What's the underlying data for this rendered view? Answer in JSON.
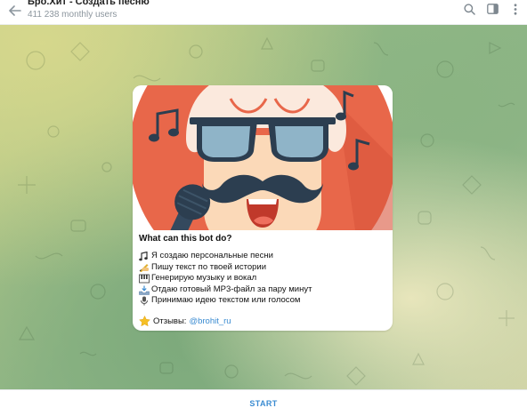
{
  "header": {
    "title": "Бро.Хит - Создать песню",
    "subtitle": "411 238 monthly users",
    "icons": [
      "back-arrow-icon",
      "search-icon",
      "sidebar-icon",
      "more-vertical-icon"
    ]
  },
  "card": {
    "title": "What can this bot do?",
    "features": [
      {
        "icon": "musical-notes-icon",
        "text": "Я создаю персональные песни"
      },
      {
        "icon": "writing-hand-icon",
        "text": "Пишу текст по твоей истории"
      },
      {
        "icon": "piano-icon",
        "text": "Генерирую музыку и вокал"
      },
      {
        "icon": "inbox-tray-icon",
        "text": "Отдаю готовый MP3-файл за пару минут"
      },
      {
        "icon": "microphone-icon",
        "text": "Принимаю идею текстом или голосом"
      }
    ],
    "review_label": "Отзывы:",
    "review_link": "@brohit_ru",
    "review_icon": "star-icon"
  },
  "footer": {
    "start_label": "START"
  },
  "colors": {
    "accent": "#3a8bd1",
    "hero_circle": "#e8674a",
    "glasses": "#2c3e50",
    "lens": "#8fb4c8"
  }
}
